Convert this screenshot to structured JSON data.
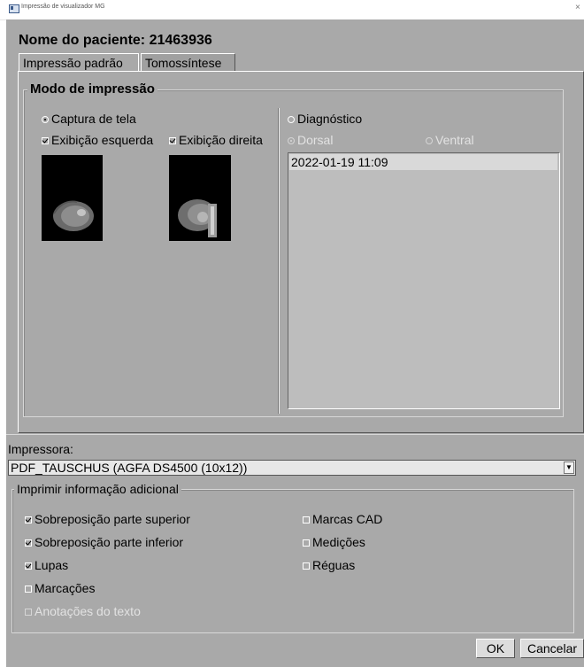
{
  "window": {
    "title": "Impressão de visualizador MG",
    "close_glyph": "×",
    "app_icon": "window-app-icon"
  },
  "patient": {
    "label": "Nome do paciente: 21463936"
  },
  "tabs": [
    {
      "label": "Impressão padrão",
      "active": true
    },
    {
      "label": "Tomossíntese",
      "active": false
    }
  ],
  "print_mode": {
    "legend": "Modo de impressão",
    "screen_capture": {
      "label": "Captura de tela",
      "selected": true
    },
    "left_view": {
      "label": "Exibição esquerda",
      "checked": true
    },
    "right_view": {
      "label": "Exibição direita",
      "checked": true
    },
    "diagnostic": {
      "label": "Diagnóstico",
      "selected": false
    },
    "dorsal": {
      "label": "Dorsal",
      "selected": true,
      "enabled": false
    },
    "ventral": {
      "label": "Ventral",
      "selected": false,
      "enabled": false
    },
    "dates": [
      "2022-01-19 11:09"
    ]
  },
  "printer": {
    "label": "Impressora:",
    "selected": "PDF_TAUSCHUS (AGFA DS4500 (10x12))"
  },
  "additional": {
    "legend": "Imprimir informação adicional",
    "left": [
      {
        "label": "Sobreposição parte superior",
        "checked": true,
        "enabled": true
      },
      {
        "label": "Sobreposição parte inferior",
        "checked": true,
        "enabled": true
      },
      {
        "label": "Lupas",
        "checked": true,
        "enabled": true
      },
      {
        "label": "Marcações",
        "checked": false,
        "enabled": true
      },
      {
        "label": "Anotações do texto",
        "checked": false,
        "enabled": false
      }
    ],
    "right": [
      {
        "label": "Marcas CAD",
        "checked": false,
        "enabled": true
      },
      {
        "label": "Medições",
        "checked": false,
        "enabled": true
      },
      {
        "label": "Réguas",
        "checked": false,
        "enabled": true
      }
    ]
  },
  "buttons": {
    "ok": "OK",
    "cancel": "Cancelar"
  },
  "colors": {
    "dialog_bg": "#a9a9a9",
    "list_bg": "#bdbdbd",
    "selected_row": "#d9d9d9"
  }
}
